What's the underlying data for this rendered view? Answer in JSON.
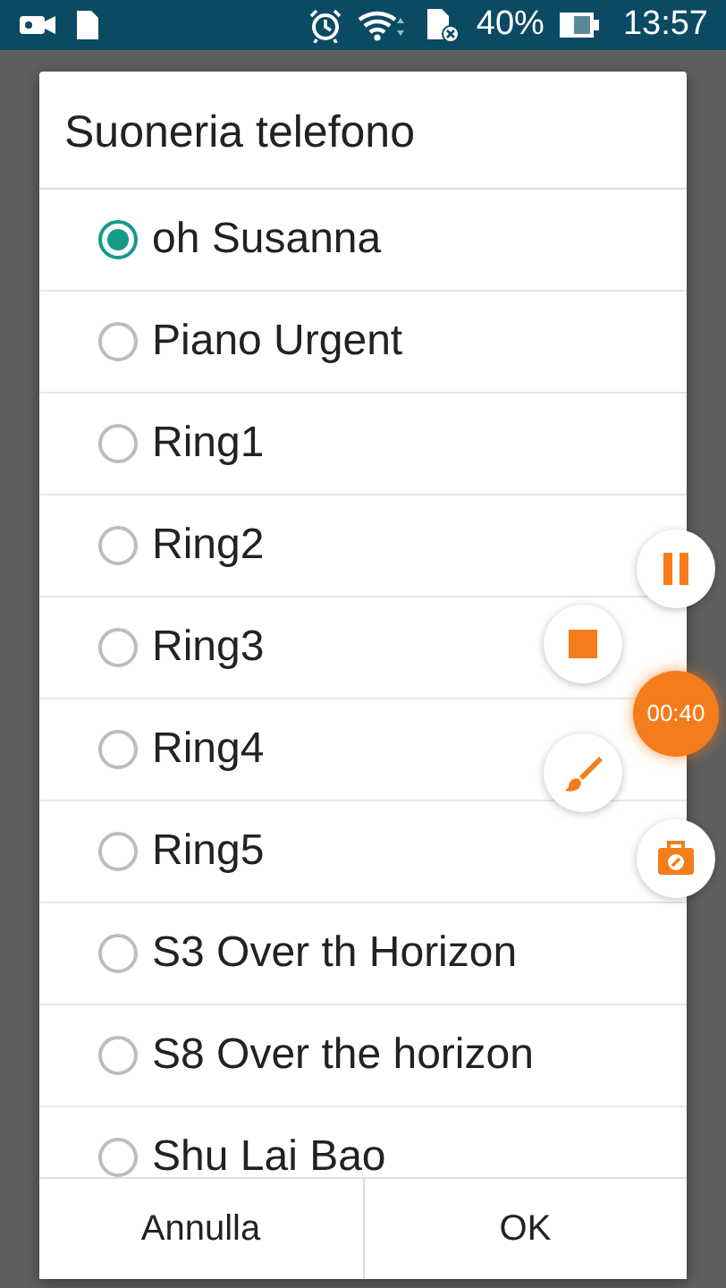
{
  "status_bar": {
    "battery_text": "40%",
    "time": "13:57"
  },
  "dialog": {
    "title": "Suoneria telefono",
    "options": [
      {
        "label": "oh Susanna",
        "selected": true
      },
      {
        "label": "Piano Urgent",
        "selected": false
      },
      {
        "label": "Ring1",
        "selected": false
      },
      {
        "label": "Ring2",
        "selected": false
      },
      {
        "label": "Ring3",
        "selected": false
      },
      {
        "label": "Ring4",
        "selected": false
      },
      {
        "label": "Ring5",
        "selected": false
      },
      {
        "label": "S3 Over th Horizon",
        "selected": false
      },
      {
        "label": "S8 Over the horizon",
        "selected": false
      },
      {
        "label": "Shu Lai Bao",
        "selected": false
      }
    ],
    "buttons": [
      "Annulla",
      "OK"
    ]
  },
  "recorder": {
    "timer": "00:40"
  }
}
